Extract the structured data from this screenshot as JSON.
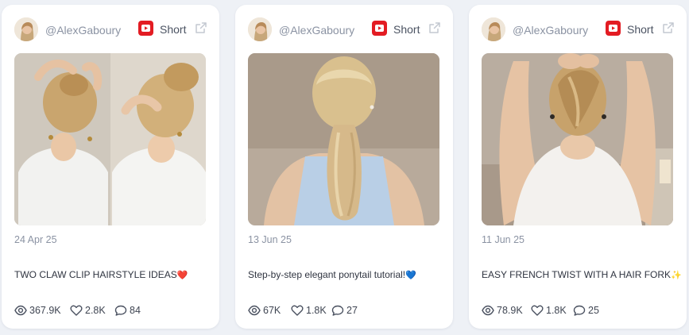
{
  "cards": [
    {
      "author": "@AlexGaboury",
      "platform": "Short",
      "platform_icon": "youtube-icon",
      "date": "24 Apr 25",
      "caption": "TWO CLAW CLIP HAIRSTYLE IDEAS",
      "caption_emoji": "❤️",
      "views": "367.9K",
      "likes": "2.8K",
      "comments": "84"
    },
    {
      "author": "@AlexGaboury",
      "platform": "Short",
      "platform_icon": "youtube-icon",
      "date": "13 Jun 25",
      "caption": "Step-by-step elegant ponytail tutorial!",
      "caption_emoji": "💙",
      "views": "67K",
      "likes": "1.8K",
      "comments": "27"
    },
    {
      "author": "@AlexGaboury",
      "platform": "Short",
      "platform_icon": "youtube-icon",
      "date": "11 Jun 25",
      "caption": "EASY FRENCH TWIST WITH A HAIR FORK",
      "caption_emoji": "✨",
      "views": "78.9K",
      "likes": "1.8K",
      "comments": "25"
    }
  ],
  "colors": {
    "youtube_red": "#e31c23",
    "muted_text": "#8b93a3",
    "body_text": "#2f3440",
    "emoji_heart_red": "#e8365d",
    "emoji_heart_blue": "#4a90e2",
    "emoji_sparkle": "#f5b83d"
  }
}
